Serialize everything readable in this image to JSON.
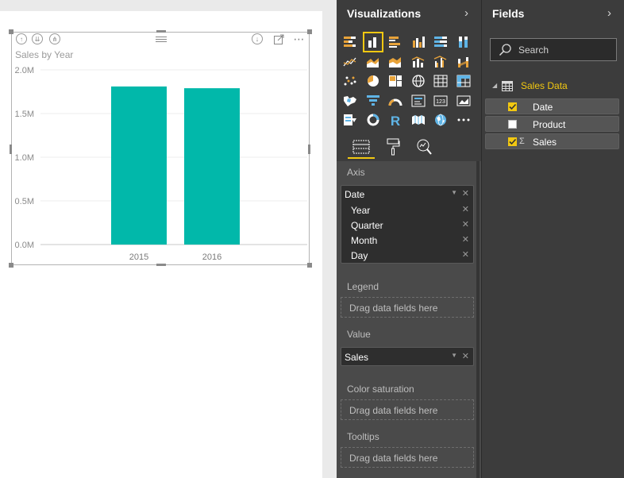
{
  "visual": {
    "title": "Sales by Year"
  },
  "chart_data": {
    "type": "bar",
    "title": "Sales by Year",
    "categories": [
      "2015",
      "2016"
    ],
    "values": [
      1810000,
      1790000
    ],
    "ylim": [
      0,
      2000000
    ],
    "yticks": [
      "0.0M",
      "0.5M",
      "1.0M",
      "1.5M",
      "2.0M"
    ],
    "ytick_values": [
      0,
      500000,
      1000000,
      1500000,
      2000000
    ],
    "grid": true,
    "bar_color": "#01b8aa"
  },
  "visualizations": {
    "title": "Visualizations",
    "selected": "clustered-column-chart",
    "wells": {
      "axis": {
        "label": "Axis",
        "field": "Date",
        "hierarchy": [
          "Year",
          "Quarter",
          "Month",
          "Day"
        ]
      },
      "legend": {
        "label": "Legend",
        "placeholder": "Drag data fields here"
      },
      "value": {
        "label": "Value",
        "field": "Sales"
      },
      "color_saturation": {
        "label": "Color saturation",
        "placeholder": "Drag data fields here"
      },
      "tooltips": {
        "label": "Tooltips",
        "placeholder": "Drag data fields here"
      }
    }
  },
  "fields": {
    "title": "Fields",
    "search": {
      "placeholder": "Search"
    },
    "table": {
      "name": "Sales Data",
      "fields": [
        {
          "name": "Date",
          "checked": true,
          "measure": false
        },
        {
          "name": "Product",
          "checked": false,
          "measure": false
        },
        {
          "name": "Sales",
          "checked": true,
          "measure": true
        }
      ]
    },
    "measure_symbol": "Σ"
  },
  "colors": {
    "accent": "#f2c811",
    "bar": "#01b8aa",
    "pane_bg": "#3c3c3c"
  }
}
